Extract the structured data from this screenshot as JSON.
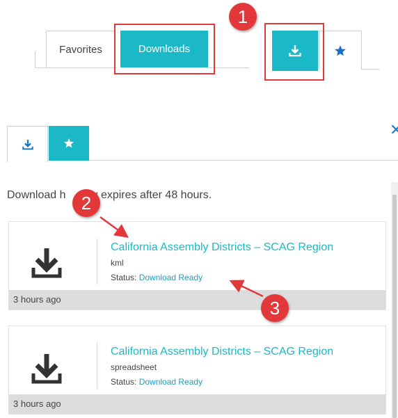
{
  "top_tabs": {
    "favorites_label": "Favorites",
    "downloads_label": "Downloads"
  },
  "callouts": [
    "1",
    "2",
    "3"
  ],
  "panel": {
    "notice_start": "Download h",
    "notice_end": "y expires after 48 hours."
  },
  "downloads": [
    {
      "title": "California Assembly Districts – SCAG Region",
      "file_type": "kml",
      "status_label": "Status: ",
      "status_value": "Download Ready",
      "age": "3 hours ago"
    },
    {
      "title": "California Assembly Districts – SCAG Region",
      "file_type": "spreadsheet",
      "status_label": "Status: ",
      "status_value": "Download Ready",
      "age": "3 hours ago"
    }
  ],
  "colors": {
    "accent": "#1bb9c8",
    "highlight_red": "#e2383a",
    "link_blue": "#1a9ec4"
  },
  "icons": {
    "download": "download-icon",
    "star": "star-icon",
    "close": "close-icon"
  }
}
